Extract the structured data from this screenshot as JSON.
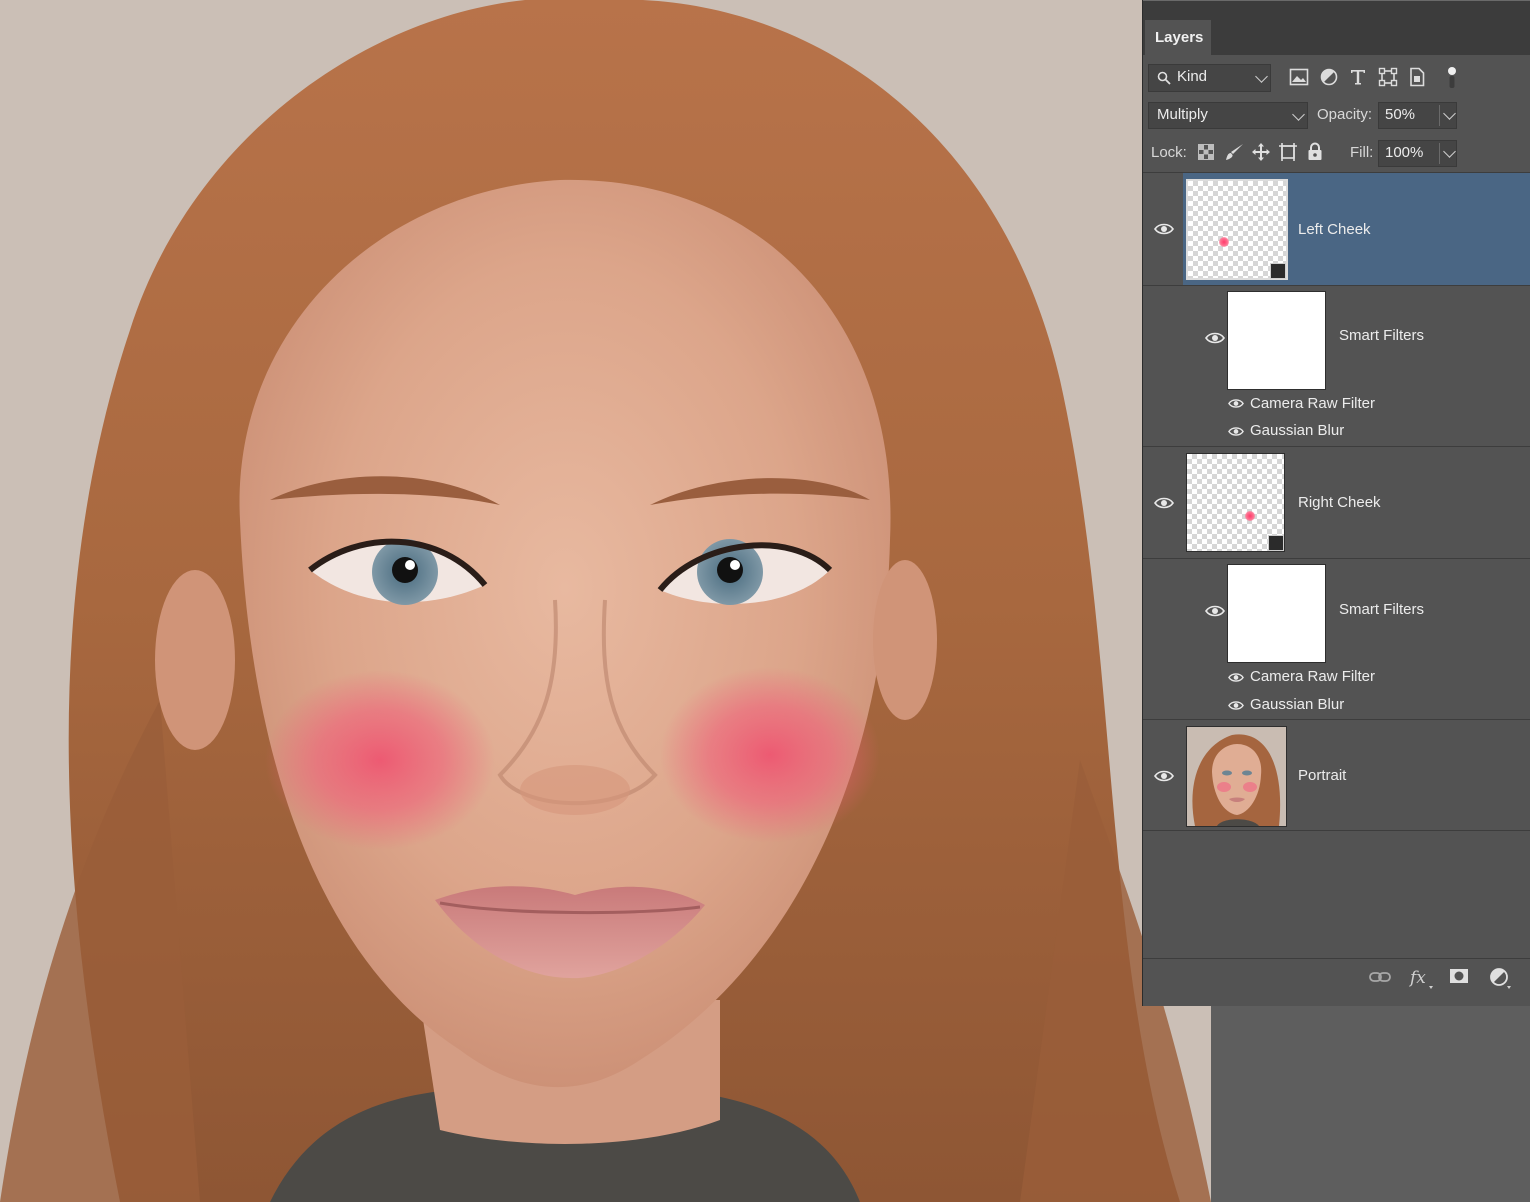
{
  "panel": {
    "tab_label": "Layers",
    "filter": {
      "kind_label": "Kind"
    },
    "blend_mode": "Multiply",
    "opacity_label": "Opacity:",
    "opacity_value": "50%",
    "lock_label": "Lock:",
    "fill_label": "Fill:",
    "fill_value": "100%",
    "layers": [
      {
        "name": "Left Cheek",
        "selected": true,
        "smart_object": true,
        "smart_filters_label": "Smart Filters",
        "filters": [
          "Camera Raw Filter",
          "Gaussian Blur"
        ]
      },
      {
        "name": "Right Cheek",
        "selected": false,
        "smart_object": true,
        "smart_filters_label": "Smart Filters",
        "filters": [
          "Camera Raw Filter",
          "Gaussian Blur"
        ]
      },
      {
        "name": "Portrait",
        "selected": false,
        "smart_object": false
      }
    ],
    "footer_icons": [
      "link-icon",
      "fx-icon",
      "mask-icon",
      "adjustment-icon"
    ]
  },
  "colors": {
    "selected_row": "#4a6684",
    "panel_bg": "#535353",
    "blush": "#f0607a"
  }
}
